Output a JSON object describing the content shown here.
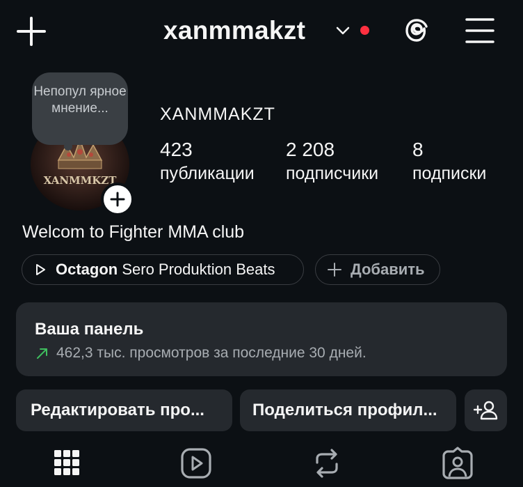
{
  "header": {
    "username": "xanmmakzt"
  },
  "profile": {
    "note": "Непопул ярное мнение...",
    "display_name": "XANMMAKZT",
    "avatar_text": "XANMMKZT",
    "stats": [
      {
        "value": "423",
        "label": "публикации"
      },
      {
        "value": "2 208",
        "label": "подписчики"
      },
      {
        "value": "8",
        "label": "подписки"
      }
    ],
    "bio": "Welcom to Fighter MMA club"
  },
  "chips": {
    "music_title": "Octagon",
    "music_artist": " Sero Produktion Beats",
    "add_label": "Добавить"
  },
  "dashboard": {
    "title": "Ваша панель",
    "subtitle": "462,3 тыс. просмотров за последние 30 дней."
  },
  "buttons": {
    "edit": "Редактировать про...",
    "share": "Поделиться профил..."
  },
  "icons": {
    "top": [
      "plus-icon",
      "chevron-down-icon",
      "threads-icon",
      "menu-icon"
    ],
    "tabs": [
      "grid-icon",
      "reels-icon",
      "reposts-icon",
      "tagged-icon"
    ]
  },
  "colors": {
    "background": "#0c1014",
    "notification_dot": "#ff3040",
    "trend_arrow": "#3fbf5f",
    "panel": "#25292e"
  }
}
